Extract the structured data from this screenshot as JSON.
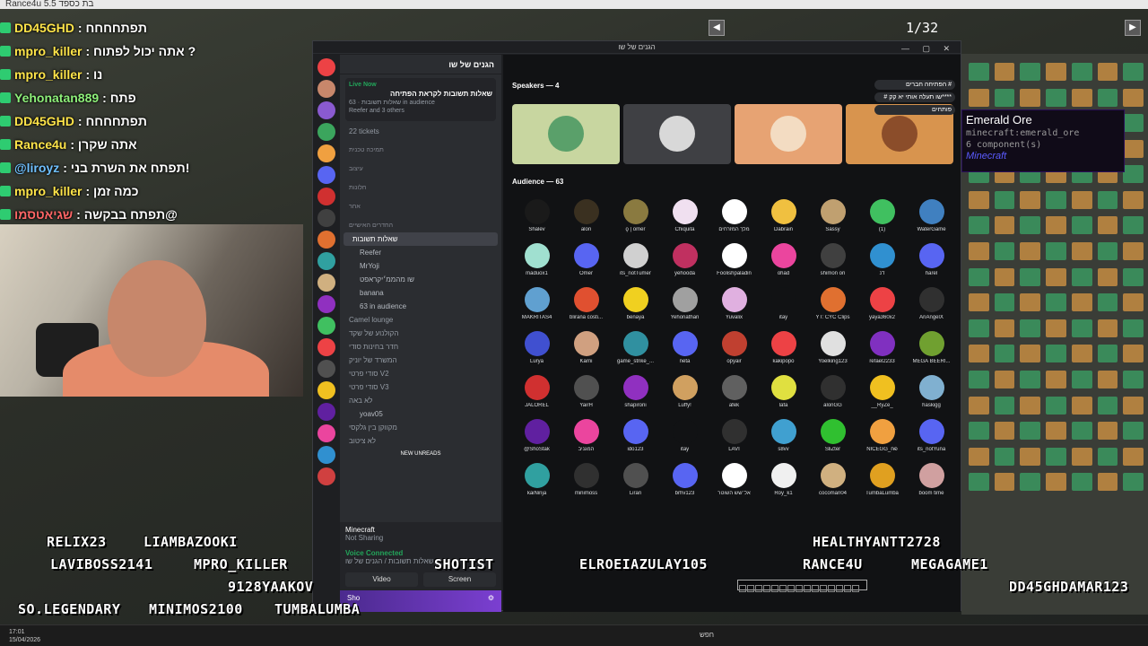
{
  "window": {
    "title_partial": "Rance4u",
    "title_suffix": "בת כספד 5.5"
  },
  "chat": [
    {
      "name": "DD45GHD",
      "msg": ": תפתחחחח",
      "color": "#ffe54a"
    },
    {
      "name": "mpro_killer",
      "msg": ": אתה יכול לפתוח ?",
      "color": "#ffe54a"
    },
    {
      "name": "mpro_killer",
      "msg": ": נו",
      "color": "#ffe54a"
    },
    {
      "name": "Yehonatan889",
      "msg": ": פתח",
      "color": "#8ef07a"
    },
    {
      "name": "DD45GHD",
      "msg": ": תפתחחחח",
      "color": "#ffe54a"
    },
    {
      "name": "Rance4u",
      "msg": ": אתה שקרן",
      "color": "#ffe54a"
    },
    {
      "name": "@liroyz",
      "msg": ": תפתח את השרת בני!",
      "color": "#6fc0ff"
    },
    {
      "name": "mpro_killer",
      "msg": ": כמה זמן",
      "color": "#ffe54a"
    },
    {
      "name": "שגיאטסמו",
      "msg": ": תפתח בבקשה@",
      "color": "#ff6666"
    }
  ],
  "webcam": {
    "label": "webcam"
  },
  "overlay_names": {
    "relix": "RELIX23",
    "liam": "LIAMBAZOOKI",
    "lavi": "LAVIBOSS2141",
    "mpro": "MPRO_KILLER",
    "shotist": "SHOTIST",
    "elroei": "ELROEIAZULAY105",
    "rance": "RANCE4U",
    "mega": "MEGAGAME1",
    "healthy": "HEALTHYANTT2728",
    "yaakov": "9128YAAKOV",
    "legendary": "SO.LEGENDARY",
    "minimos": "MINIMOS2100",
    "tumba": "TUMBALUMBA",
    "dd45": "DD45GHDAMAR123"
  },
  "pager": {
    "label": "1/32",
    "prev": "◀",
    "next": "▶"
  },
  "tooltip": {
    "name": "Emerald Ore",
    "id": "minecraft:emerald_ore",
    "components": "6 component(s)",
    "mod": "Minecraft"
  },
  "discord": {
    "title": "הגנים של שו",
    "server_name": "הגנים של שו",
    "live": {
      "tag": "Live Now",
      "title": "שאלות תשובות לקראת הפתיחה",
      "sub": "שאלות תשובות · 63 in audience",
      "hosts": "Reefer and 3 others"
    },
    "channels": [
      {
        "name": "22 tickets",
        "type": "ch"
      },
      {
        "name": "תמיכה טכנית",
        "type": "cat"
      },
      {
        "name": "עיצוב",
        "type": "cat"
      },
      {
        "name": "חלונות",
        "type": "cat"
      },
      {
        "name": "אחר",
        "type": "cat"
      },
      {
        "name": "החדרים האישיים",
        "type": "cat"
      },
      {
        "name": "שאלות תשובות",
        "type": "sel"
      },
      {
        "name": "Reefer",
        "type": "sub"
      },
      {
        "name": "MrYoji",
        "type": "sub"
      },
      {
        "name": "שו מהממ׳יקראפט",
        "type": "sub"
      },
      {
        "name": "banana",
        "type": "sub"
      },
      {
        "name": "63 in audience",
        "type": "sub"
      },
      {
        "name": "Camel lounge",
        "type": "ch"
      },
      {
        "name": "הקולנוע של שקד",
        "type": "ch"
      },
      {
        "name": "חדר בחינות סודי",
        "type": "ch"
      },
      {
        "name": "המשרד של יוניק",
        "type": "ch"
      },
      {
        "name": "סודי פרטי V2",
        "type": "ch"
      },
      {
        "name": "סודי פרטי V3",
        "type": "ch"
      },
      {
        "name": "לא באה",
        "type": "ch"
      },
      {
        "name": "yoav05",
        "type": "sub"
      },
      {
        "name": "מקווקן בין גלקסי",
        "type": "ch"
      },
      {
        "name": "לא ציטוב",
        "type": "ch"
      }
    ],
    "new_unreads": "NEW UNREADS",
    "activity": {
      "title": "Minecraft",
      "status": "Not Sharing"
    },
    "voice": {
      "status": "Voice Connected",
      "channel": "שאלות תשובות / הגנים של שו"
    },
    "video_btn": "Video",
    "screen_btn": "Screen",
    "user": "Sho",
    "speakers_label": "Speakers — 4",
    "audience_label": "Audience — 63",
    "speaker_badges": [
      "הפתיחה חברים #",
      "# שו תעלה אותי יא קק****",
      "פותחים"
    ],
    "speakers": [
      {
        "color": "#c8d6a0",
        "av": "#5aa06a"
      },
      {
        "color": "#3f4044",
        "av": "#d8d8d8"
      },
      {
        "color": "#e7a373",
        "av": "#f3dcc2"
      },
      {
        "color": "#d8944e",
        "av": "#8b4d2a"
      }
    ],
    "audience": [
      {
        "n": "Shalev",
        "c": "#1a1a1a"
      },
      {
        "n": "alon",
        "c": "#3a3020"
      },
      {
        "n": "ϙ | omer",
        "c": "#8a7a40"
      },
      {
        "n": "Chiquita",
        "c": "#f0e0f0"
      },
      {
        "n": "מלך המזרחים",
        "c": "#ffffff"
      },
      {
        "n": "Dabrain",
        "c": "#f0c040"
      },
      {
        "n": "Sassy",
        "c": "#c0a070"
      },
      {
        "n": "(1)",
        "c": "#40c060"
      },
      {
        "n": "WaterGame",
        "c": "#4080c0"
      },
      {
        "n": "maduox1",
        "c": "#a0e0d0"
      },
      {
        "n": "Omer",
        "c": "#5865f2"
      },
      {
        "n": "its_notTumer",
        "c": "#d0d0d0"
      },
      {
        "n": "yehooda",
        "c": "#c03060"
      },
      {
        "n": "Foolishpaladin",
        "c": "#ffffff"
      },
      {
        "n": "ohad",
        "c": "#eb459e"
      },
      {
        "n": "shimon ori",
        "c": "#404040"
      },
      {
        "n": "דנ",
        "c": "#3090d0"
      },
      {
        "n": "harel",
        "c": "#5865f2"
      },
      {
        "n": "MAKRITAS4",
        "c": "#60a0d0"
      },
      {
        "n": "blirana costi...",
        "c": "#e05030"
      },
      {
        "n": "benaya",
        "c": "#f0d020"
      },
      {
        "n": "Yehonathan",
        "c": "#a0a0a0"
      },
      {
        "n": "Yuvalix",
        "c": "#e0b0e0"
      },
      {
        "n": "itay",
        "c": "#111214"
      },
      {
        "n": "YT: CYC Clips",
        "c": "#e07030"
      },
      {
        "n": "yaya360x2",
        "c": "#ed4245"
      },
      {
        "n": "AriAngelX",
        "c": "#303030"
      },
      {
        "n": "Lurya",
        "c": "#4050d0"
      },
      {
        "n": "Karni",
        "c": "#d0a080"
      },
      {
        "n": "game_strike_...",
        "c": "#3090a0"
      },
      {
        "n": "neta",
        "c": "#5865f2"
      },
      {
        "n": "opyair",
        "c": "#c04030"
      },
      {
        "n": "kakipopo",
        "c": "#ed4245"
      },
      {
        "n": "Yoelking123",
        "c": "#e0e0e0"
      },
      {
        "n": "refael2233",
        "c": "#8030c0"
      },
      {
        "n": "MEGA BEERI...",
        "c": "#70a030"
      },
      {
        "n": "JALOREL",
        "c": "#d03030"
      },
      {
        "n": "YairH",
        "c": "#505050"
      },
      {
        "n": "shapironi",
        "c": "#9030c0"
      },
      {
        "n": "Luffy!",
        "c": "#d0a060"
      },
      {
        "n": "afek",
        "c": "#606060"
      },
      {
        "n": "lafa",
        "c": "#e0e040"
      },
      {
        "n": "alonGG",
        "c": "#303030"
      },
      {
        "n": "__RyZe_",
        "c": "#f0c020"
      },
      {
        "n": "haskigg",
        "c": "#80b0d0"
      },
      {
        "n": "@ShoStak",
        "c": "#6020a0"
      },
      {
        "n": "המגניב",
        "c": "#eb459e"
      },
      {
        "n": "ido123",
        "c": "#5865f2"
      },
      {
        "n": "itay",
        "c": "#111214"
      },
      {
        "n": "LAVI",
        "c": "#303030"
      },
      {
        "n": "s8vv",
        "c": "#40a0d0"
      },
      {
        "n": "SliZter",
        "c": "#30c030"
      },
      {
        "n": "NICEGG_פ̶ח",
        "c": "#f0a040"
      },
      {
        "n": "its_notYuna",
        "c": "#5865f2"
      },
      {
        "n": "kaiNinja",
        "c": "#30a0a0"
      },
      {
        "n": "minimoss",
        "c": "#303030"
      },
      {
        "n": "Liran",
        "c": "#505050"
      },
      {
        "n": "brhv123",
        "c": "#5865f2"
      },
      {
        "n": "אל׳שש השוטר",
        "c": "#ffffff"
      },
      {
        "n": "Roy_k1",
        "c": "#f0f0f0"
      },
      {
        "n": "cocoman04",
        "c": "#d0b080"
      },
      {
        "n": "TumbaLumba",
        "c": "#e0a020"
      },
      {
        "n": "boom time",
        "c": "#d0a0a0"
      }
    ]
  },
  "clock": {
    "time": "17:01",
    "date": "15/04/2026"
  },
  "taskbar": {
    "search": "חפש"
  },
  "colors": {
    "discord_bg": "#1e1f22",
    "accent": "#5865f2",
    "live": "#23a55a"
  }
}
